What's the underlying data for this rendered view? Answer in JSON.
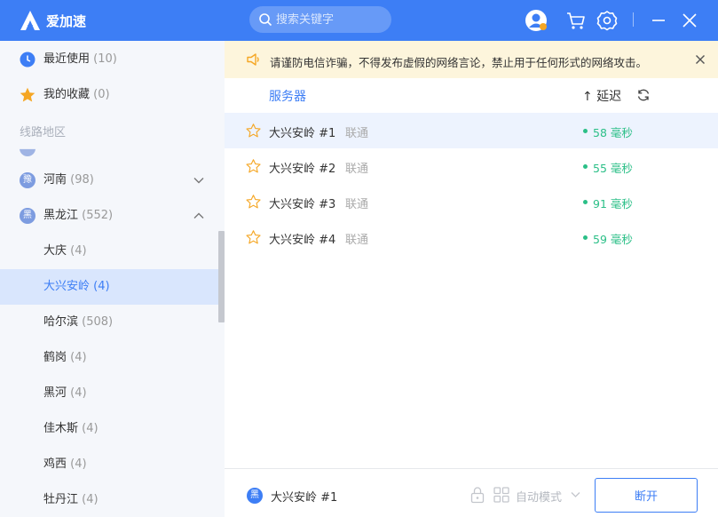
{
  "header": {
    "app_title": "爱加速",
    "search_placeholder": "搜索关键字",
    "icons": [
      "avatar-icon",
      "cart-icon",
      "gear-icon",
      "minimize-icon",
      "close-icon"
    ]
  },
  "sidebar": {
    "recent": {
      "label": "最近使用",
      "count": "(10)"
    },
    "favorites": {
      "label": "我的收藏",
      "count": "(0)"
    },
    "section_label": "线路地区",
    "provinces": [
      {
        "badge": "豫",
        "label": "河南",
        "count": "(98)"
      },
      {
        "badge": "黑",
        "label": "黑龙江",
        "count": "(552)"
      }
    ],
    "cities": [
      {
        "label": "大庆",
        "count": "(4)"
      },
      {
        "label": "大兴安岭",
        "count": "(4)"
      },
      {
        "label": "哈尔滨",
        "count": "(508)"
      },
      {
        "label": "鹤岗",
        "count": "(4)"
      },
      {
        "label": "黑河",
        "count": "(4)"
      },
      {
        "label": "佳木斯",
        "count": "(4)"
      },
      {
        "label": "鸡西",
        "count": "(4)"
      },
      {
        "label": "牡丹江",
        "count": "(4)"
      }
    ]
  },
  "notice": {
    "text": "请谨防电信诈骗，不得发布虚假的网络言论，禁止用于任何形式的网络攻击。"
  },
  "table": {
    "col_server": "服务器",
    "col_delay": "↑ 延迟",
    "rows": [
      {
        "name": "大兴安岭 #1",
        "isp": "联通",
        "ping": "58 毫秒"
      },
      {
        "name": "大兴安岭 #2",
        "isp": "联通",
        "ping": "55 毫秒"
      },
      {
        "name": "大兴安岭 #3",
        "isp": "联通",
        "ping": "91 毫秒"
      },
      {
        "name": "大兴安岭 #4",
        "isp": "联通",
        "ping": "59 毫秒"
      }
    ]
  },
  "footer": {
    "badge": "黑",
    "current_server": "大兴安岭 #1",
    "mode_label": "自动模式",
    "disconnect_label": "断开"
  },
  "colors": {
    "accent": "#3d7ef5",
    "ping_green": "#2bbf87",
    "notice_bg": "#fdf5dc"
  }
}
